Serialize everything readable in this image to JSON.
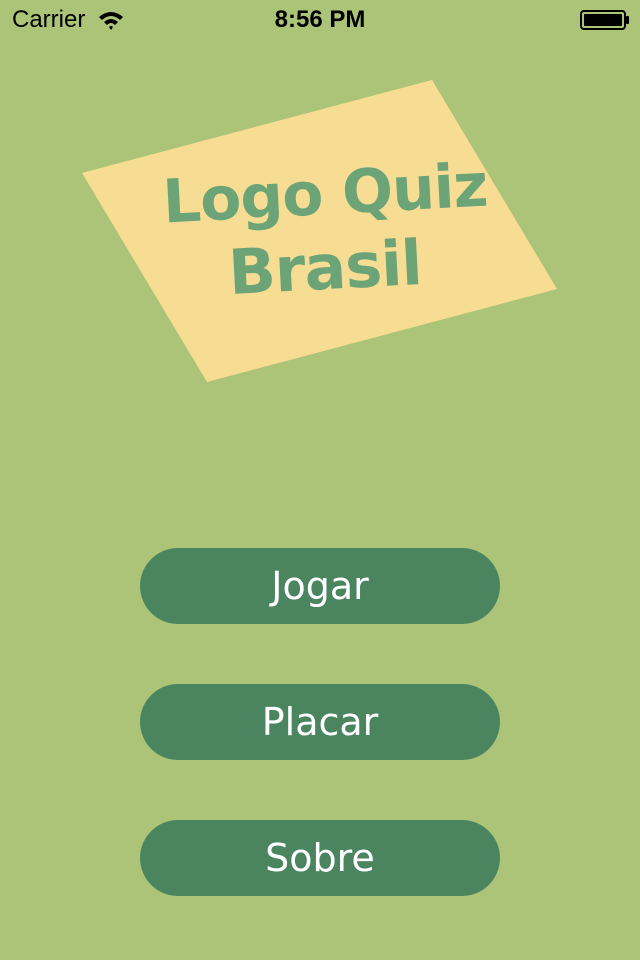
{
  "status_bar": {
    "carrier": "Carrier",
    "time": "8:56 PM",
    "wifi_icon": "wifi-icon",
    "battery_icon": "battery-icon"
  },
  "logo": {
    "line1": "Logo Quiz",
    "line2": "Brasil",
    "card_color": "#f7dd93",
    "text_color": "#6ca477"
  },
  "menu": {
    "play_label": "Jogar",
    "score_label": "Placar",
    "about_label": "Sobre",
    "button_color": "#4b8560"
  },
  "colors": {
    "background": "#acc477"
  }
}
